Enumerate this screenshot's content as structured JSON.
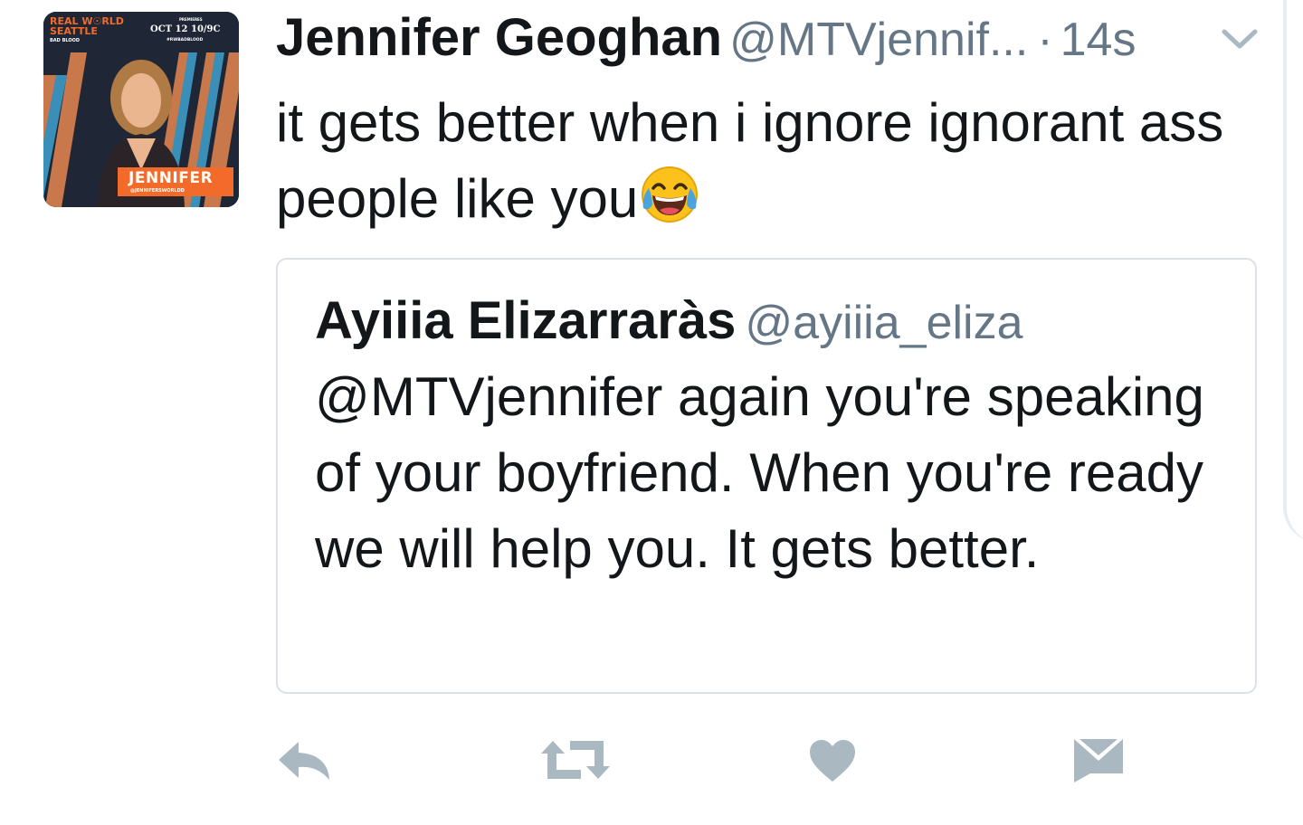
{
  "tweet": {
    "author_name": "Jennifer Geoghan",
    "author_handle": "@MTVjennif...",
    "separator": "·",
    "timestamp": "14s",
    "text": "it gets better when i ignore ignorant ass people like you",
    "emoji": "face-with-tears-of-joy"
  },
  "avatar": {
    "brand_line1": "REAL W☉RLD",
    "brand_line2": "SEATTLE",
    "brand_sub": "BAD BLOOD",
    "premieres": "PREMIERES",
    "date": "OCT 12 10/9C",
    "hashtag": "#RWBADBLOOD",
    "name": "JENNIFER",
    "name_handle": "@JENNIFERSWORLDD"
  },
  "quoted_tweet": {
    "author_name": "Ayiiia Elizarraràs",
    "author_handle": "@ayiiia_eliza",
    "text": "@MTVjennifer again you're speaking of your boyfriend. When you're ready we will help you. It gets better."
  },
  "actions": [
    "reply-icon",
    "retweet-icon",
    "like-icon",
    "direct-message-icon"
  ],
  "colors": {
    "text": "#14171a",
    "secondary": "#657786",
    "icons": "#aab8c2",
    "border": "#dbe1e6"
  }
}
